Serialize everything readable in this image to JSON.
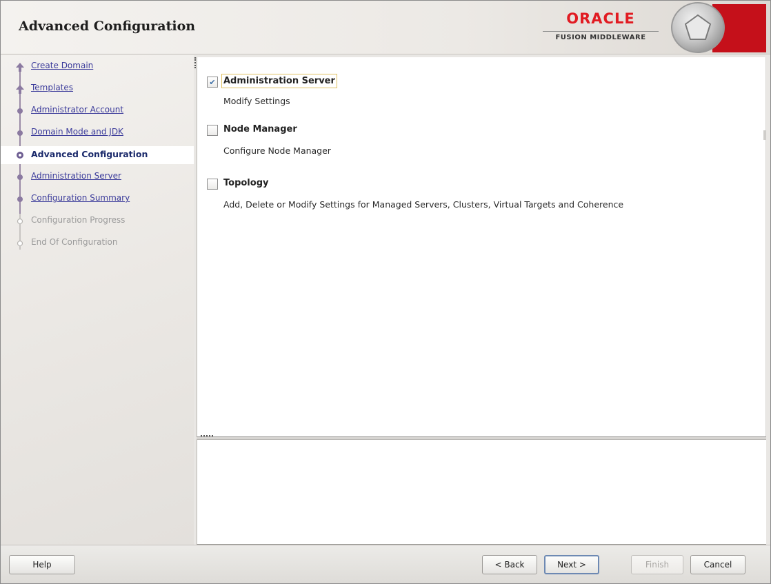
{
  "header": {
    "title": "Advanced Configuration",
    "logo_brand": "ORACLE",
    "logo_product": "FUSION MIDDLEWARE"
  },
  "sidebar": {
    "steps": [
      {
        "label": "Create Domain",
        "state": "done"
      },
      {
        "label": "Templates",
        "state": "done"
      },
      {
        "label": "Administrator Account",
        "state": "done"
      },
      {
        "label": "Domain Mode and JDK",
        "state": "done"
      },
      {
        "label": "Advanced Configuration",
        "state": "current"
      },
      {
        "label": "Administration Server",
        "state": "next"
      },
      {
        "label": "Configuration Summary",
        "state": "next"
      },
      {
        "label": "Configuration Progress",
        "state": "disabled"
      },
      {
        "label": "End Of Configuration",
        "state": "disabled"
      }
    ]
  },
  "options": [
    {
      "label": "Administration Server",
      "description": "Modify Settings",
      "checked": true
    },
    {
      "label": "Node Manager",
      "description": "Configure Node Manager",
      "checked": false
    },
    {
      "label": "Topology",
      "description": "Add, Delete or Modify Settings for Managed Servers, Clusters, Virtual Targets and Coherence",
      "checked": false
    }
  ],
  "buttons": {
    "help": "Help",
    "back": "< Back",
    "next": "Next >",
    "finish": "Finish",
    "cancel": "Cancel"
  },
  "colors": {
    "brand_red": "#e11b22",
    "link_blue": "#3a3a9a",
    "current_step": "#1b2a6b"
  }
}
